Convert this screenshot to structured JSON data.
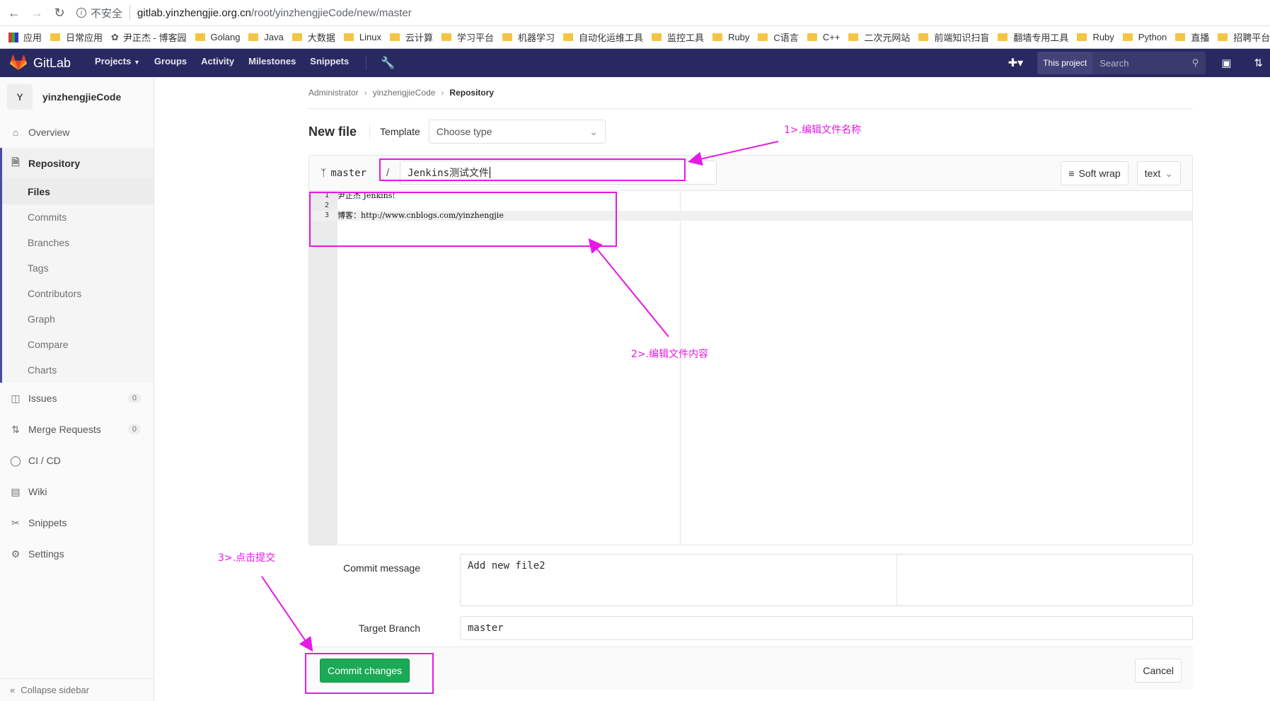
{
  "browser": {
    "insecure_label": "不安全",
    "url_domain": "gitlab.yinzhengjie.org.cn",
    "url_path": "/root/yinzhengjieCode/new/master",
    "bookmarks": [
      "应用",
      "日常应用",
      "尹正杰 - 博客园",
      "Golang",
      "Java",
      "大数据",
      "Linux",
      "云计算",
      "学习平台",
      "机器学习",
      "自动化运维工具",
      "监控工具",
      "Ruby",
      "C语言",
      "C++",
      "二次元网站",
      "前端知识扫盲",
      "翻墙专用工具",
      "Ruby",
      "Python",
      "直播",
      "招聘平台"
    ]
  },
  "header": {
    "brand": "GitLab",
    "nav": [
      "Projects",
      "Groups",
      "Activity",
      "Milestones",
      "Snippets"
    ],
    "scope_label": "This project",
    "search_placeholder": "Search"
  },
  "sidebar": {
    "avatar_letter": "Y",
    "project_name": "yinzhengjieCode",
    "overview": "Overview",
    "repository": "Repository",
    "repo_items": [
      "Files",
      "Commits",
      "Branches",
      "Tags",
      "Contributors",
      "Graph",
      "Compare",
      "Charts"
    ],
    "issues": "Issues",
    "issues_count": "0",
    "merge_requests": "Merge Requests",
    "mr_count": "0",
    "cicd": "CI / CD",
    "wiki": "Wiki",
    "snippets": "Snippets",
    "settings": "Settings",
    "collapse": "Collapse sidebar"
  },
  "breadcrumb": [
    "Administrator",
    "yinzhengjieCode",
    "Repository"
  ],
  "page": {
    "title": "New file",
    "template_label": "Template",
    "template_select": "Choose type"
  },
  "editor": {
    "branch": "master",
    "slash": "/",
    "file_name": "Jenkins测试文件",
    "soft_wrap": "Soft wrap",
    "mode": "text",
    "lines": [
      {
        "n": "1",
        "t": "尹正杰  Jenkins!"
      },
      {
        "n": "2",
        "t": ""
      },
      {
        "n": "3",
        "t": "博客：http://www.cnblogs.com/yinzhengjie"
      }
    ]
  },
  "form": {
    "commit_message_label": "Commit message",
    "commit_message": "Add new file2",
    "target_branch_label": "Target Branch",
    "target_branch": "master",
    "commit_button": "Commit changes",
    "cancel_button": "Cancel"
  },
  "annotations": {
    "a1": "1>.编辑文件名称",
    "a2": "2>.编辑文件内容",
    "a3": "3>.点击提交"
  },
  "colors": {
    "header_bg": "#292961",
    "commit_green": "#1aaa55",
    "annotation_magenta": "#e619e6"
  }
}
